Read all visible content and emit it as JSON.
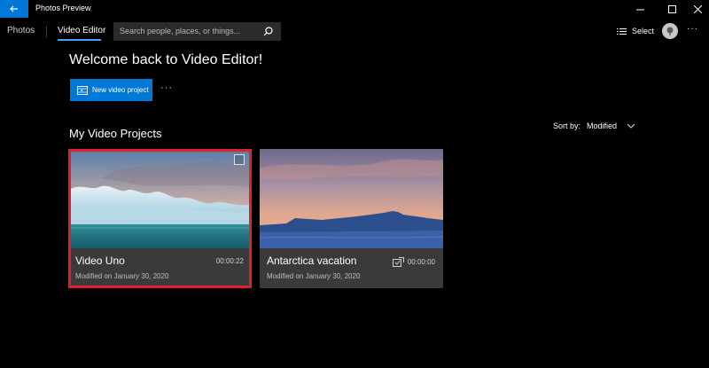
{
  "window": {
    "title": "Photos Preview"
  },
  "nav": {
    "tabs": [
      {
        "label": "Photos"
      },
      {
        "label": "Video Editor",
        "active": true
      }
    ],
    "search": {
      "placeholder": "Search people, places, or things..."
    },
    "select_label": "Select",
    "more_label": "···"
  },
  "main": {
    "welcome": "Welcome back to Video Editor!",
    "new_project_label": "New video project",
    "more_label": "···",
    "section_title": "My Video Projects",
    "sort": {
      "label": "Sort by:",
      "value": "Modified"
    }
  },
  "projects": [
    {
      "title": "Video Uno",
      "duration": "00:00:22",
      "modified": "Modified on January 30, 2020",
      "selected": true
    },
    {
      "title": "Antarctica vacation",
      "duration": "00:00:00",
      "modified": "Modified on January 30, 2020",
      "selected": false
    }
  ],
  "colors": {
    "accent": "#0078d7",
    "selection": "#e0212a",
    "card_bg": "#3a3a3a"
  }
}
